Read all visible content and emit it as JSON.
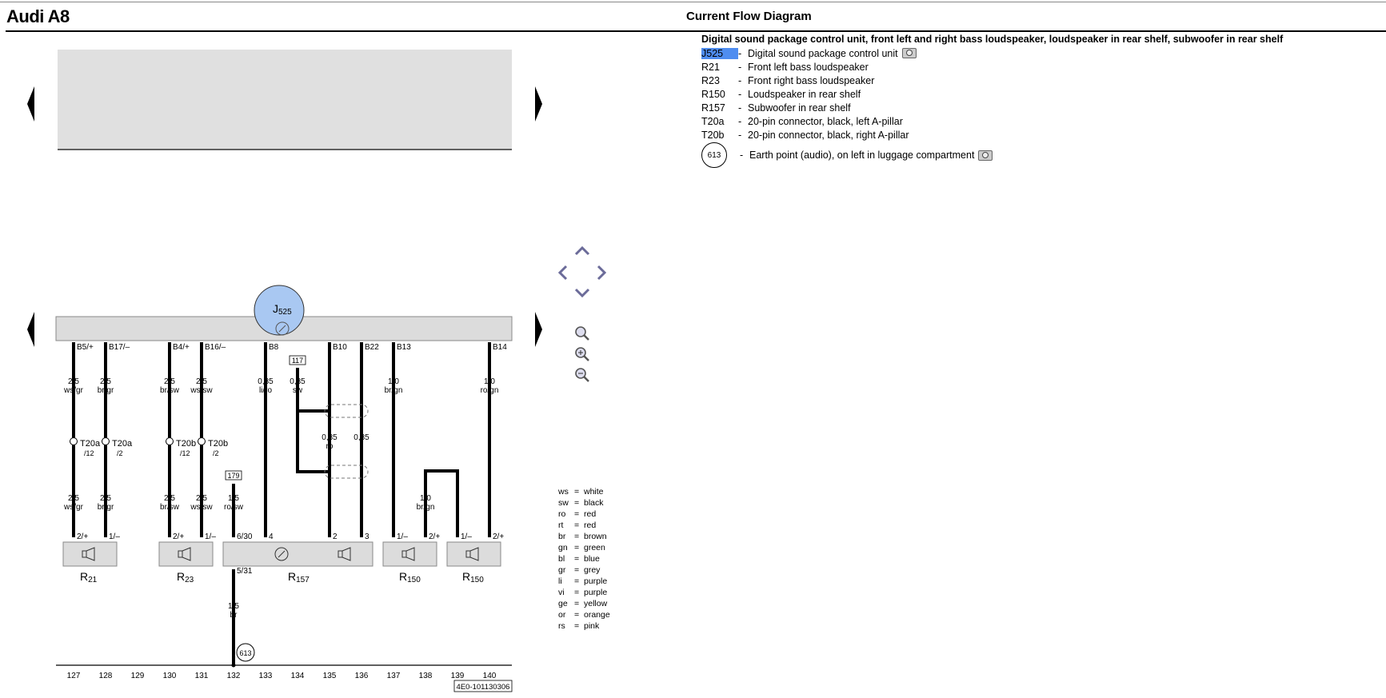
{
  "app_title": "Audi A8",
  "diagram_heading": "Current Flow Diagram",
  "legend": {
    "title": "Digital sound package control unit, front left and right bass loudspeaker, loudspeaker in rear shelf, subwoofer in rear shelf",
    "items": [
      {
        "code": "J525",
        "desc": "Digital sound package control unit",
        "camera": true,
        "highlighted": true
      },
      {
        "code": "R21",
        "desc": "Front left bass loudspeaker"
      },
      {
        "code": "R23",
        "desc": "Front right bass loudspeaker"
      },
      {
        "code": "R150",
        "desc": "Loudspeaker in rear shelf"
      },
      {
        "code": "R157",
        "desc": "Subwoofer in rear shelf"
      },
      {
        "code": "T20a",
        "desc": "20-pin connector, black, left A-pillar"
      },
      {
        "code": "T20b",
        "desc": "20-pin connector, black, right A-pillar"
      }
    ],
    "earth": {
      "code": "613",
      "desc": "Earth point (audio), on left in luggage compartment",
      "camera": true
    },
    "dash": "-"
  },
  "color_key": [
    {
      "abbr": "ws",
      "name": "white"
    },
    {
      "abbr": "sw",
      "name": "black"
    },
    {
      "abbr": "ro",
      "name": "red"
    },
    {
      "abbr": "rt",
      "name": "red"
    },
    {
      "abbr": "br",
      "name": "brown"
    },
    {
      "abbr": "gn",
      "name": "green"
    },
    {
      "abbr": "bl",
      "name": "blue"
    },
    {
      "abbr": "gr",
      "name": "grey"
    },
    {
      "abbr": "li",
      "name": "purple"
    },
    {
      "abbr": "vi",
      "name": "purple"
    },
    {
      "abbr": "ge",
      "name": "yellow"
    },
    {
      "abbr": "or",
      "name": "orange"
    },
    {
      "abbr": "rs",
      "name": "pink"
    }
  ],
  "color_key_eq": "=",
  "diagram": {
    "control_unit": {
      "label": "J",
      "sub": "525"
    },
    "pins": [
      "B5/+",
      "B17/–",
      "B4/+",
      "B16/–",
      "B8",
      "B10",
      "B22",
      "B13",
      "B14"
    ],
    "wires_upper": [
      {
        "size": "2,5",
        "color": "ws/gr"
      },
      {
        "size": "2,5",
        "color": "br/gr"
      },
      {
        "size": "2,5",
        "color": "br/sw"
      },
      {
        "size": "2,5",
        "color": "ws/sw"
      },
      {
        "size": "0,35",
        "color": "li/ro"
      },
      {
        "size": "0,35",
        "color": "sw"
      },
      {
        "size": "1,0",
        "color": "br/gn"
      },
      {
        "size": "1,0",
        "color": "ro/gn"
      }
    ],
    "wires_mid": [
      {
        "size": "0,35",
        "color": "ro"
      },
      {
        "size": "0,35",
        "color": "li"
      }
    ],
    "connectors": [
      {
        "name": "T20a",
        "pin": "/12"
      },
      {
        "name": "T20a",
        "pin": "/2"
      },
      {
        "name": "T20b",
        "pin": "/12"
      },
      {
        "name": "T20b",
        "pin": "/2"
      }
    ],
    "wires_lower": [
      {
        "size": "2,5",
        "color": "ws/gr"
      },
      {
        "size": "2,5",
        "color": "br/gr"
      },
      {
        "size": "2,5",
        "color": "br/sw"
      },
      {
        "size": "2,5",
        "color": "ws/sw"
      },
      {
        "size": "1,5",
        "color": "ro/sw"
      },
      {
        "size": "1,0",
        "color": "br/gn"
      }
    ],
    "ref_boxes": [
      "117",
      "179"
    ],
    "component_pins": [
      "2/+",
      "1/–",
      "2/+",
      "1/–",
      "6/30",
      "4",
      "2",
      "3",
      "1/–",
      "2/+",
      "1/–",
      "2/+"
    ],
    "components": [
      {
        "label": "R",
        "sub": "21"
      },
      {
        "label": "R",
        "sub": "23"
      },
      {
        "label": "R",
        "sub": "157"
      },
      {
        "label": "R",
        "sub": "150"
      },
      {
        "label": "R",
        "sub": "150"
      }
    ],
    "earth_wire": {
      "pin": "5/31",
      "size": "1,5",
      "color": "br"
    },
    "earth_point": "613",
    "tracks": [
      "127",
      "128",
      "129",
      "130",
      "131",
      "132",
      "133",
      "134",
      "135",
      "136",
      "137",
      "138",
      "139",
      "140"
    ],
    "doc_id": "4E0-101130306"
  }
}
